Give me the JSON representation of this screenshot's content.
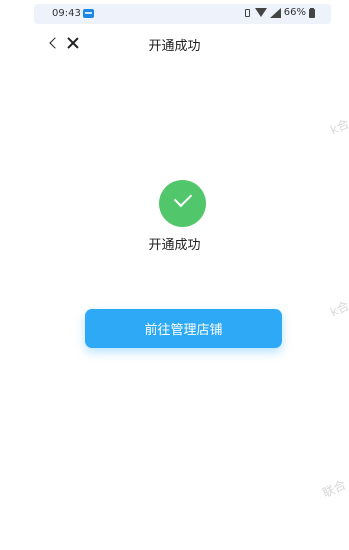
{
  "status_bar": {
    "time": "09:43",
    "battery": "66%"
  },
  "nav": {
    "title": "开通成功"
  },
  "main": {
    "success_text": "开通成功",
    "button_label": "前往管理店铺"
  },
  "watermarks": [
    "k合",
    "k合",
    "联合"
  ],
  "colors": {
    "accent": "#2da9f5",
    "success": "#52c66a"
  }
}
